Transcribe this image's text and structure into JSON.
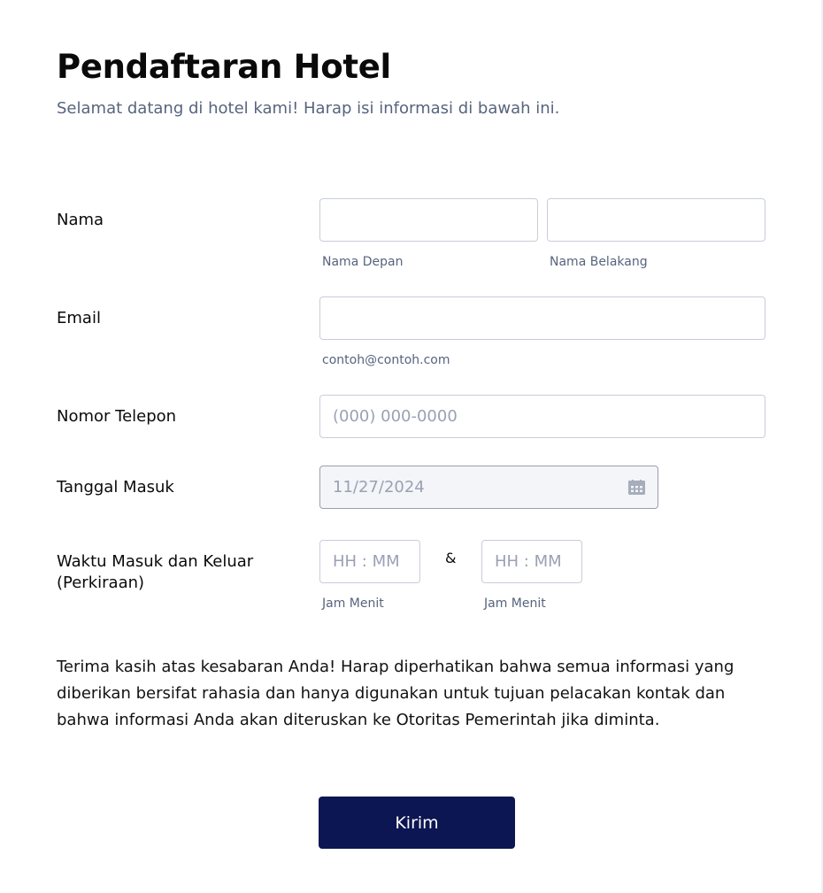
{
  "header": {
    "title": "Pendaftaran Hotel",
    "subtitle": "Selamat datang di hotel kami! Harap isi informasi di bawah ini."
  },
  "form": {
    "name": {
      "label": "Nama",
      "first_value": "",
      "first_sublabel": "Nama Depan",
      "last_value": "",
      "last_sublabel": "Nama Belakang"
    },
    "email": {
      "label": "Email",
      "value": "",
      "sublabel": "contoh@contoh.com"
    },
    "phone": {
      "label": "Nomor Telepon",
      "placeholder": "(000) 000-0000"
    },
    "checkin_date": {
      "label": "Tanggal Masuk",
      "value": "11/27/2024",
      "icon": "calendar-icon"
    },
    "times": {
      "label_line1": "Waktu Masuk dan Keluar",
      "label_line2": "(Perkiraan)",
      "in_placeholder": "HH : MM",
      "in_sublabel": "Jam Menit",
      "separator": "&",
      "out_placeholder": "HH : MM",
      "out_sublabel": "Jam Menit"
    }
  },
  "notice": "Terima kasih atas kesabaran Anda! Harap diperhatikan bahwa semua informasi yang diberikan bersifat rahasia dan hanya digunakan untuk tujuan pelacakan kontak dan bahwa informasi Anda akan diteruskan ke Otoritas Pemerintah jika diminta.",
  "submit_label": "Kirim",
  "colors": {
    "button_bg": "#0c1652",
    "subtitle_text": "#57647e",
    "input_border": "#c8cdd8",
    "date_bg": "#f4f5f8"
  }
}
